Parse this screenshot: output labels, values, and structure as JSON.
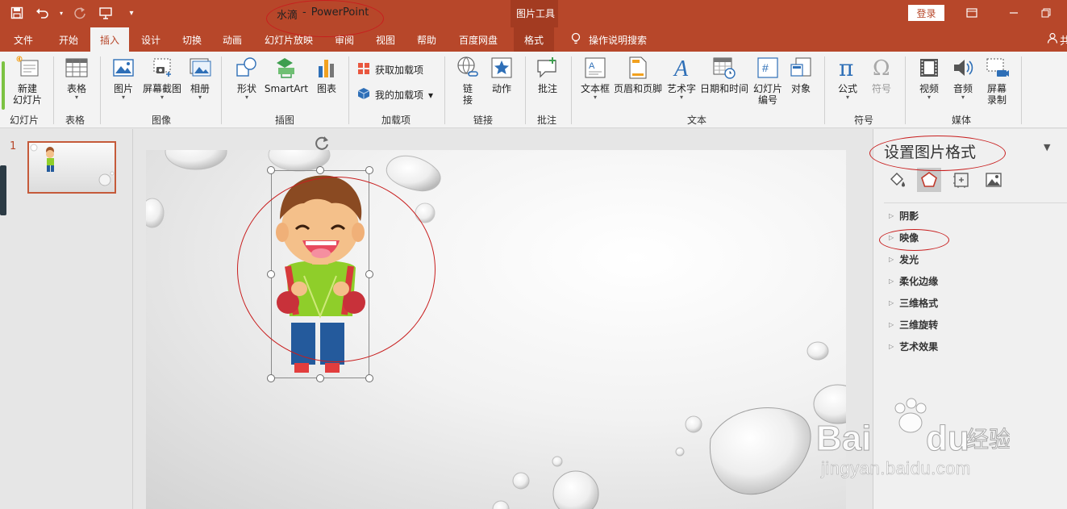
{
  "title_bar": {
    "doc_name": "水滴",
    "separator": "-",
    "app_name": "PowerPoint",
    "context_tab_title": "图片工具",
    "login_label": "登录",
    "qat_icons": [
      "save-icon",
      "undo-icon",
      "redo-icon",
      "present-icon",
      "customize-icon"
    ],
    "colors": {
      "brand": "#b7472a",
      "ribbon_bg": "#f3f3f3"
    }
  },
  "tabs": [
    {
      "label": "文件",
      "active": false
    },
    {
      "label": "开始",
      "active": false
    },
    {
      "label": "插入",
      "active": true
    },
    {
      "label": "设计",
      "active": false
    },
    {
      "label": "切换",
      "active": false
    },
    {
      "label": "动画",
      "active": false
    },
    {
      "label": "幻灯片放映",
      "active": false
    },
    {
      "label": "审阅",
      "active": false
    },
    {
      "label": "视图",
      "active": false
    },
    {
      "label": "帮助",
      "active": false
    },
    {
      "label": "百度网盘",
      "active": false
    },
    {
      "label": "格式",
      "active": false
    }
  ],
  "tell_me": "操作说明搜索",
  "share_label": "共",
  "ribbon": {
    "buttons": {
      "new_slide": "新建\n幻灯片",
      "table": "表格",
      "picture": "图片",
      "screenshot": "屏幕截图",
      "album": "相册",
      "shapes": "形状",
      "smartart": "SmartArt",
      "chart": "图表",
      "get_addins": "获取加载项",
      "my_addins": "我的加载项",
      "link": "链\n接",
      "action": "动作",
      "comment": "批注",
      "textbox": "文本框",
      "header_footer": "页眉和页脚",
      "wordart": "艺术字",
      "datetime": "日期和时间",
      "slide_number": "幻灯片\n编号",
      "object": "对象",
      "equation": "公式",
      "symbol": "符号",
      "video": "视频",
      "audio": "音频",
      "screen_record": "屏幕\n录制"
    },
    "groups": {
      "slides": "幻灯片",
      "tables": "表格",
      "images": "图像",
      "illustrations": "插图",
      "addins": "加载项",
      "links": "链接",
      "comments": "批注",
      "text": "文本",
      "symbols": "符号",
      "media": "媒体"
    }
  },
  "thumbnails": {
    "slide_number": "1"
  },
  "format_pane": {
    "title": "设置图片格式",
    "tabs": [
      "fill-line-icon",
      "effects-icon",
      "size-properties-icon",
      "picture-icon"
    ],
    "sections": [
      "阴影",
      "映像",
      "发光",
      "柔化边缘",
      "三维格式",
      "三维旋转",
      "艺术效果"
    ]
  },
  "watermark": {
    "text": "jingyan.baidu.com"
  }
}
